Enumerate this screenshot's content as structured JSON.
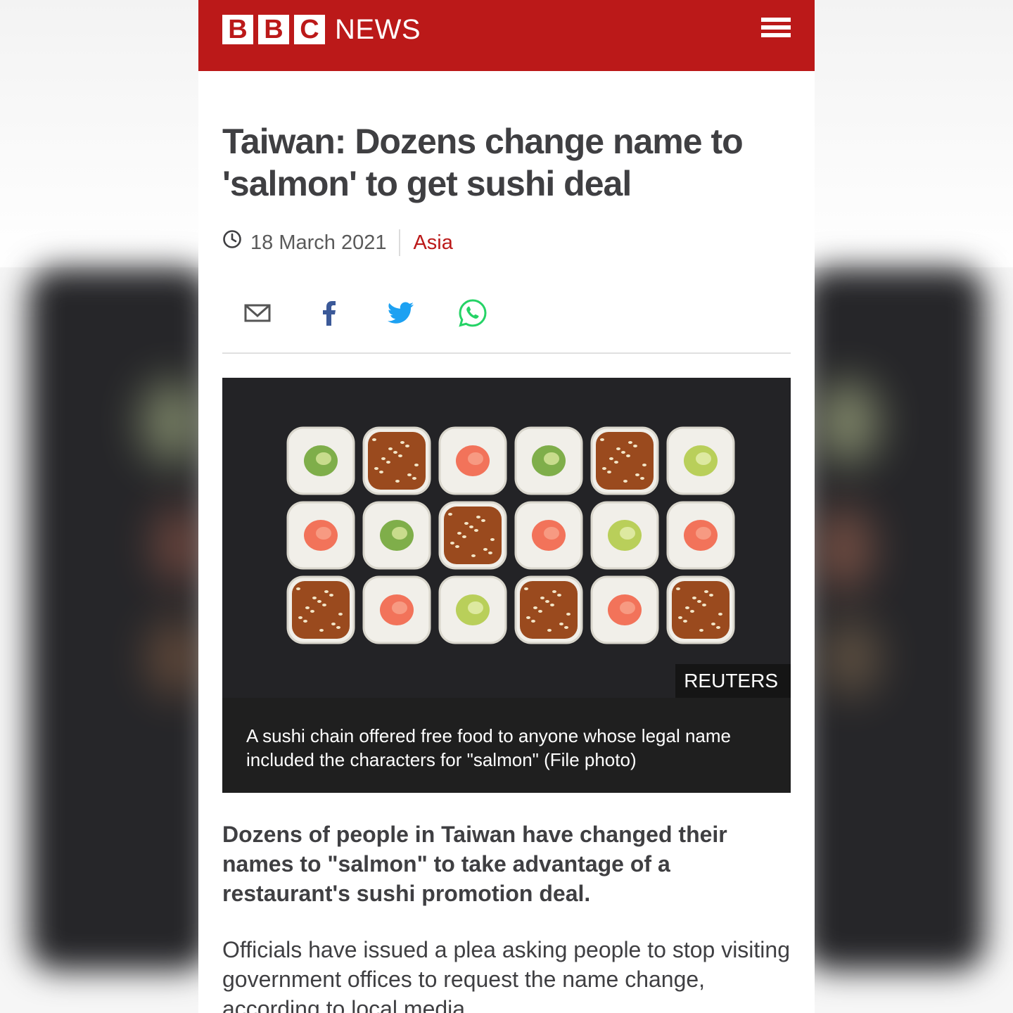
{
  "masthead": {
    "logo_letters": [
      "B",
      "B",
      "C"
    ],
    "logo_word": "NEWS",
    "menu_icon": "hamburger-menu-icon",
    "brand_color": "#bb1919"
  },
  "article": {
    "headline": "Taiwan: Dozens change name to 'salmon' to get sushi deal",
    "date": "18 March 2021",
    "section": "Asia",
    "share_icons": [
      "email-icon",
      "facebook-icon",
      "twitter-icon",
      "whatsapp-icon"
    ],
    "image_credit": "REUTERS",
    "image_caption": "A sushi chain offered free food to anyone whose legal name included the characters for \"salmon\" (File photo)",
    "lede": "Dozens of people in Taiwan have changed their names to \"salmon\" to take advantage of a restaurant's sushi promotion deal.",
    "body": "Officials have issued a plea asking people to stop visiting government offices to request the name change, according to local media."
  },
  "colors": {
    "facebook": "#3b5998",
    "twitter": "#1da1f2",
    "whatsapp": "#25d366",
    "text": "#3f3f42"
  },
  "sushi_rows": [
    [
      "cucumber",
      "eel",
      "salmon",
      "cucumber",
      "eel",
      "avocado"
    ],
    [
      "salmon",
      "cucumber",
      "eel",
      "salmon",
      "avocado",
      "salmon"
    ],
    [
      "eel",
      "salmon",
      "avocado",
      "eel",
      "salmon",
      "eel"
    ]
  ]
}
